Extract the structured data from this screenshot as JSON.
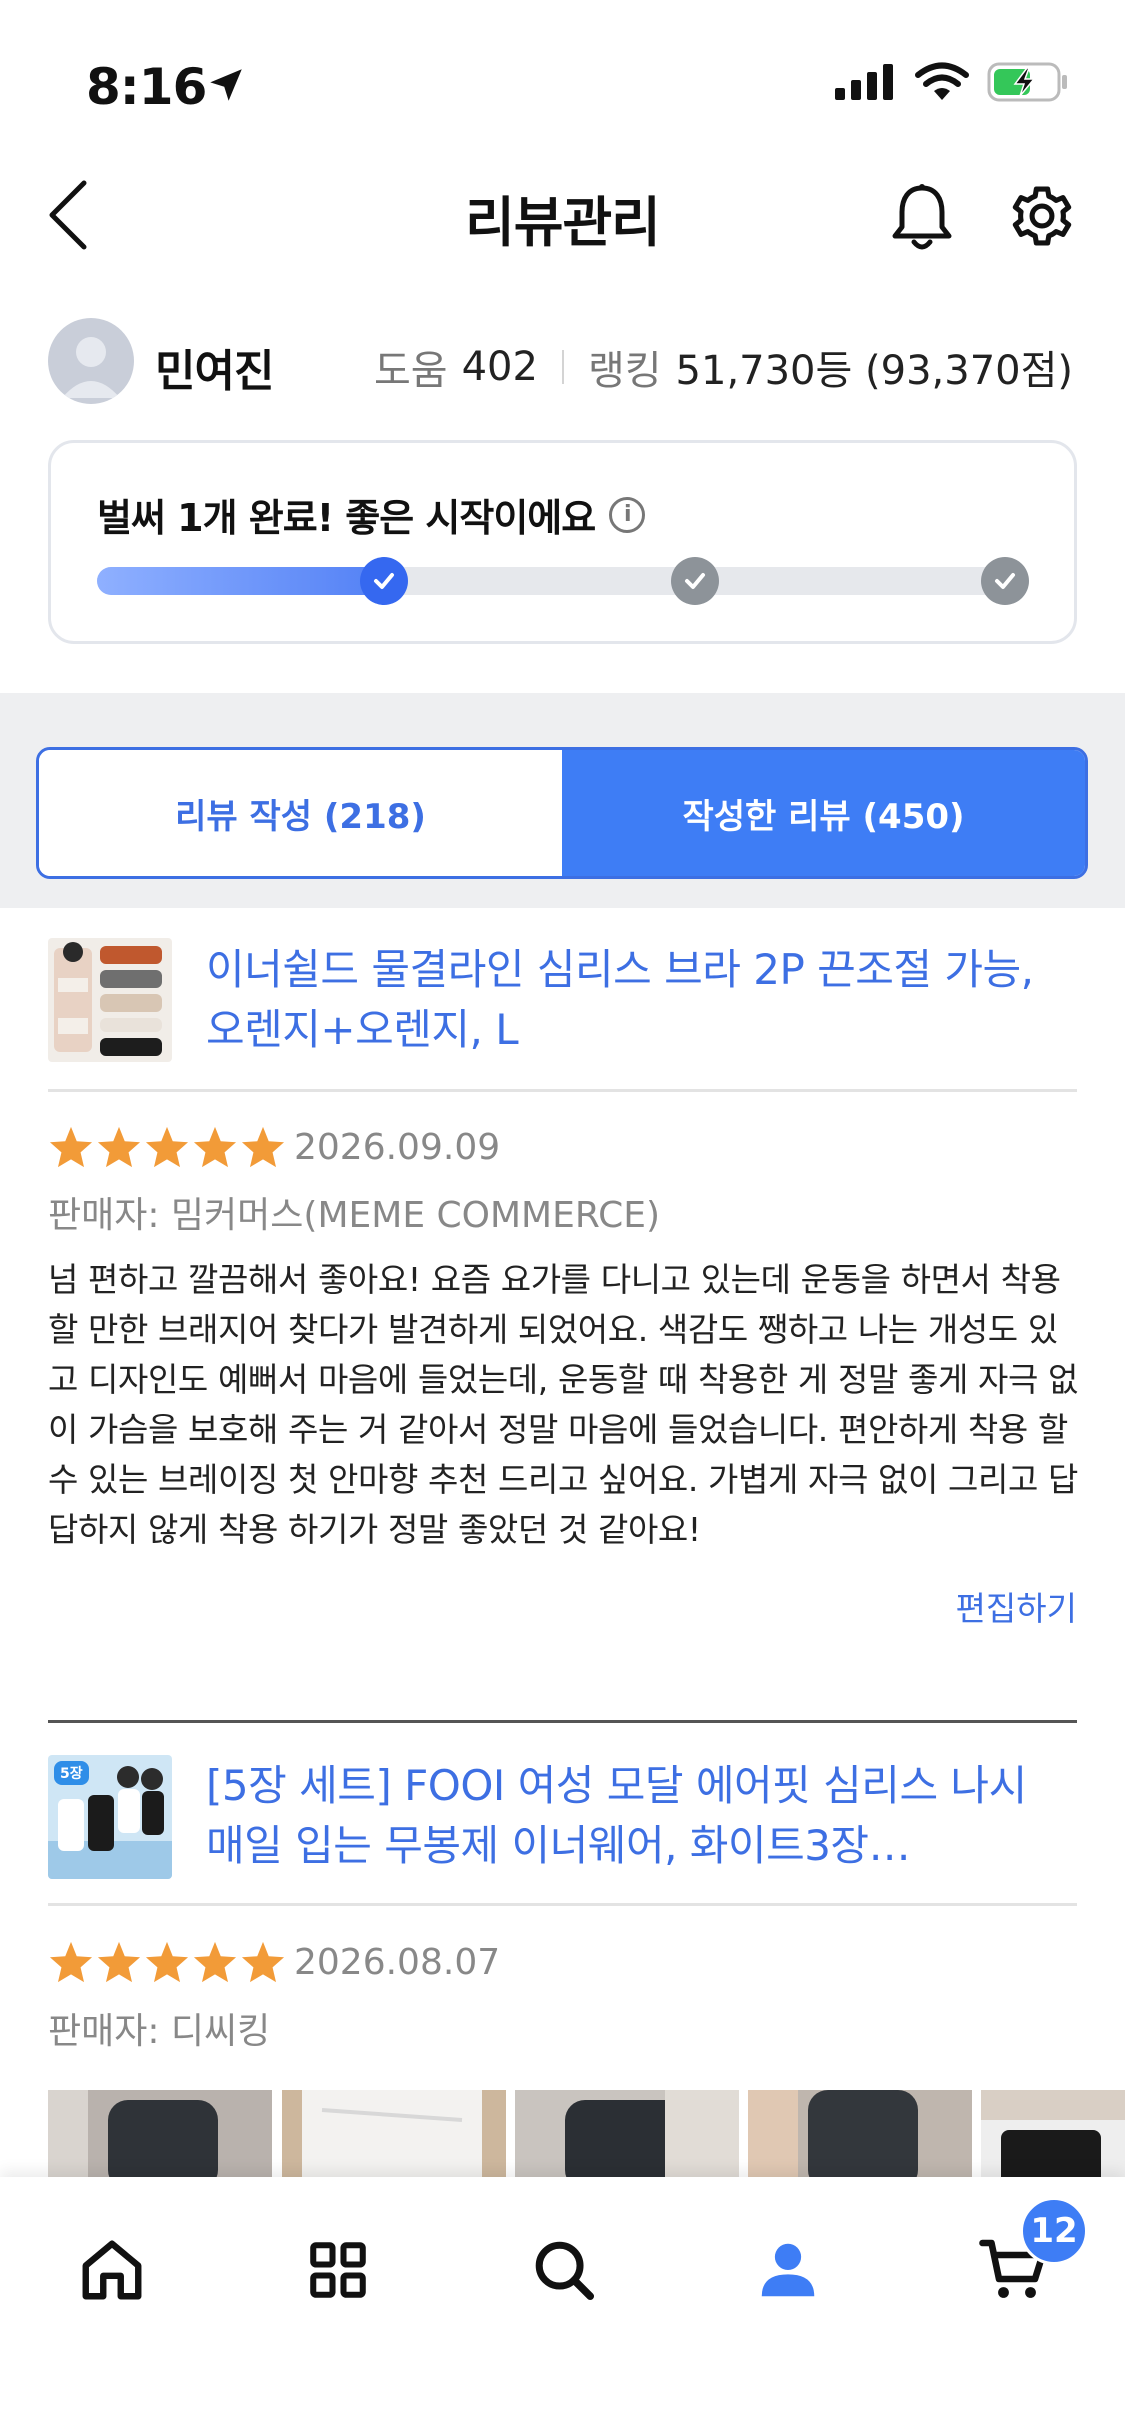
{
  "status": {
    "time": "8:16"
  },
  "header": {
    "title": "리뷰관리"
  },
  "profile": {
    "name": "민여진",
    "help_label": "도움",
    "help_value": "402",
    "rank_label": "랭킹",
    "rank_value": "51,730등 (93,370점)"
  },
  "progress": {
    "message": "벌써 1개 완료! 좋은 시작이에요",
    "info_glyph": "i",
    "completed_steps": 1,
    "total_steps": 3,
    "fill_fraction": 0.33
  },
  "tabs": [
    {
      "label": "리뷰 작성 (218)",
      "active": false
    },
    {
      "label": "작성한 리뷰 (450)",
      "active": true
    }
  ],
  "reviews": [
    {
      "product_title": "이너쉴드 물결라인 심리스 브라 2P 끈조절 가능, 오렌지+오렌지, L",
      "rating": 5,
      "date": "2026.09.09",
      "seller": "판매자: 밈커머스(MEME COMMERCE)",
      "text": "넘 편하고 깔끔해서 좋아요! 요즘 요가를 다니고 있는데 운동을 하면서 착용 할 만한 브래지어 찾다가 발견하게 되었어요. 색감도 쨍하고 나는 개성도 있고 디자인도 예뻐서 마음에 들었는데, 운동할 때 착용한 게 정말 좋게 자극 없이 가슴을 보호해 주는 거 같아서 정말 마음에 들었습니다. 편안하게 착용 할 수 있는 브레이징 첫 안마향 추천 드리고 싶어요. 가볍게 자극 없이 그리고 답답하지 않게 착용 하기가 정말 좋았던 것 같아요!",
      "edit_label": "편집하기"
    },
    {
      "product_title": "[5장 세트] FOOI 여성 모달 에어핏 심리스 나시 매일 입는 무봉제 이너웨어, 화이트3장…",
      "thumb_badge": "5장",
      "rating": 5,
      "date": "2026.08.07",
      "seller": "판매자: 디씨킹"
    }
  ],
  "cart": {
    "count": "12"
  },
  "colors": {
    "accent": "#3e7df5",
    "star": "#f29b38",
    "link": "#3d6fe3"
  }
}
